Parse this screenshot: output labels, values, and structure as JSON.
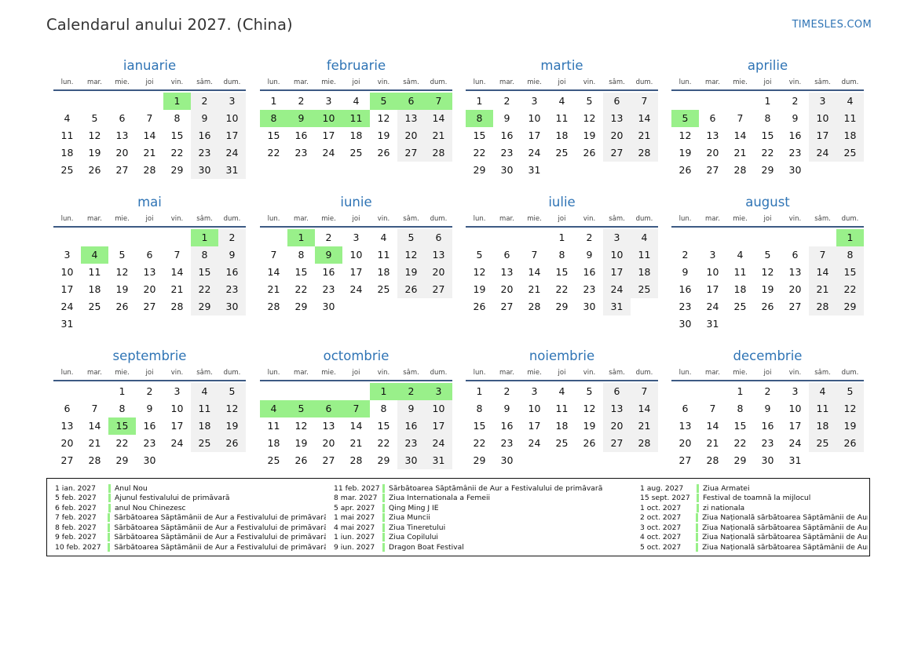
{
  "title": "Calendarul anului 2027. (China)",
  "brand": "TIMESLES.COM",
  "colors": {
    "accent": "#2f74b5",
    "holiday": "#99f08a",
    "weekend": "#f1f1f1",
    "rule": "#3d5a84"
  },
  "weekdays": [
    "lun.",
    "mar.",
    "mie.",
    "joi",
    "vin.",
    "sâm.",
    "dum."
  ],
  "months": [
    {
      "name": "ianuarie",
      "weeks": [
        [
          "",
          "",
          "",
          "",
          "1",
          "2",
          "3"
        ],
        [
          "4",
          "5",
          "6",
          "7",
          "8",
          "9",
          "10"
        ],
        [
          "11",
          "12",
          "13",
          "14",
          "15",
          "16",
          "17"
        ],
        [
          "18",
          "19",
          "20",
          "21",
          "22",
          "23",
          "24"
        ],
        [
          "25",
          "26",
          "27",
          "28",
          "29",
          "30",
          "31"
        ]
      ],
      "holidays": [
        "1"
      ]
    },
    {
      "name": "februarie",
      "weeks": [
        [
          "1",
          "2",
          "3",
          "4",
          "5",
          "6",
          "7"
        ],
        [
          "8",
          "9",
          "10",
          "11",
          "12",
          "13",
          "14"
        ],
        [
          "15",
          "16",
          "17",
          "18",
          "19",
          "20",
          "21"
        ],
        [
          "22",
          "23",
          "24",
          "25",
          "26",
          "27",
          "28"
        ]
      ],
      "holidays": [
        "5",
        "6",
        "7",
        "8",
        "9",
        "10",
        "11"
      ]
    },
    {
      "name": "martie",
      "weeks": [
        [
          "1",
          "2",
          "3",
          "4",
          "5",
          "6",
          "7"
        ],
        [
          "8",
          "9",
          "10",
          "11",
          "12",
          "13",
          "14"
        ],
        [
          "15",
          "16",
          "17",
          "18",
          "19",
          "20",
          "21"
        ],
        [
          "22",
          "23",
          "24",
          "25",
          "26",
          "27",
          "28"
        ],
        [
          "29",
          "30",
          "31",
          "",
          "",
          "",
          ""
        ]
      ],
      "holidays": [
        "8"
      ]
    },
    {
      "name": "aprilie",
      "weeks": [
        [
          "",
          "",
          "",
          "1",
          "2",
          "3",
          "4"
        ],
        [
          "5",
          "6",
          "7",
          "8",
          "9",
          "10",
          "11"
        ],
        [
          "12",
          "13",
          "14",
          "15",
          "16",
          "17",
          "18"
        ],
        [
          "19",
          "20",
          "21",
          "22",
          "23",
          "24",
          "25"
        ],
        [
          "26",
          "27",
          "28",
          "29",
          "30",
          "",
          ""
        ]
      ],
      "holidays": [
        "5"
      ]
    },
    {
      "name": "mai",
      "weeks": [
        [
          "",
          "",
          "",
          "",
          "",
          "1",
          "2"
        ],
        [
          "3",
          "4",
          "5",
          "6",
          "7",
          "8",
          "9"
        ],
        [
          "10",
          "11",
          "12",
          "13",
          "14",
          "15",
          "16"
        ],
        [
          "17",
          "18",
          "19",
          "20",
          "21",
          "22",
          "23"
        ],
        [
          "24",
          "25",
          "26",
          "27",
          "28",
          "29",
          "30"
        ],
        [
          "31",
          "",
          "",
          "",
          "",
          "",
          ""
        ]
      ],
      "holidays": [
        "1",
        "4"
      ]
    },
    {
      "name": "iunie",
      "weeks": [
        [
          "",
          "1",
          "2",
          "3",
          "4",
          "5",
          "6"
        ],
        [
          "7",
          "8",
          "9",
          "10",
          "11",
          "12",
          "13"
        ],
        [
          "14",
          "15",
          "16",
          "17",
          "18",
          "19",
          "20"
        ],
        [
          "21",
          "22",
          "23",
          "24",
          "25",
          "26",
          "27"
        ],
        [
          "28",
          "29",
          "30",
          "",
          "",
          "",
          ""
        ]
      ],
      "holidays": [
        "1",
        "9"
      ]
    },
    {
      "name": "iulie",
      "weeks": [
        [
          "",
          "",
          "",
          "1",
          "2",
          "3",
          "4"
        ],
        [
          "5",
          "6",
          "7",
          "8",
          "9",
          "10",
          "11"
        ],
        [
          "12",
          "13",
          "14",
          "15",
          "16",
          "17",
          "18"
        ],
        [
          "19",
          "20",
          "21",
          "22",
          "23",
          "24",
          "25"
        ],
        [
          "26",
          "27",
          "28",
          "29",
          "30",
          "31",
          ""
        ]
      ],
      "holidays": []
    },
    {
      "name": "august",
      "weeks": [
        [
          "",
          "",
          "",
          "",
          "",
          "",
          "1"
        ],
        [
          "2",
          "3",
          "4",
          "5",
          "6",
          "7",
          "8"
        ],
        [
          "9",
          "10",
          "11",
          "12",
          "13",
          "14",
          "15"
        ],
        [
          "16",
          "17",
          "18",
          "19",
          "20",
          "21",
          "22"
        ],
        [
          "23",
          "24",
          "25",
          "26",
          "27",
          "28",
          "29"
        ],
        [
          "30",
          "31",
          "",
          "",
          "",
          "",
          ""
        ]
      ],
      "holidays": [
        "1"
      ]
    },
    {
      "name": "septembrie",
      "weeks": [
        [
          "",
          "",
          "1",
          "2",
          "3",
          "4",
          "5"
        ],
        [
          "6",
          "7",
          "8",
          "9",
          "10",
          "11",
          "12"
        ],
        [
          "13",
          "14",
          "15",
          "16",
          "17",
          "18",
          "19"
        ],
        [
          "20",
          "21",
          "22",
          "23",
          "24",
          "25",
          "26"
        ],
        [
          "27",
          "28",
          "29",
          "30",
          "",
          "",
          ""
        ]
      ],
      "holidays": [
        "15"
      ]
    },
    {
      "name": "octombrie",
      "weeks": [
        [
          "",
          "",
          "",
          "",
          "1",
          "2",
          "3"
        ],
        [
          "4",
          "5",
          "6",
          "7",
          "8",
          "9",
          "10"
        ],
        [
          "11",
          "12",
          "13",
          "14",
          "15",
          "16",
          "17"
        ],
        [
          "18",
          "19",
          "20",
          "21",
          "22",
          "23",
          "24"
        ],
        [
          "25",
          "26",
          "27",
          "28",
          "29",
          "30",
          "31"
        ]
      ],
      "holidays": [
        "1",
        "2",
        "3",
        "4",
        "5",
        "6",
        "7"
      ]
    },
    {
      "name": "noiembrie",
      "weeks": [
        [
          "1",
          "2",
          "3",
          "4",
          "5",
          "6",
          "7"
        ],
        [
          "8",
          "9",
          "10",
          "11",
          "12",
          "13",
          "14"
        ],
        [
          "15",
          "16",
          "17",
          "18",
          "19",
          "20",
          "21"
        ],
        [
          "22",
          "23",
          "24",
          "25",
          "26",
          "27",
          "28"
        ],
        [
          "29",
          "30",
          "",
          "",
          "",
          "",
          ""
        ]
      ],
      "holidays": []
    },
    {
      "name": "decembrie",
      "weeks": [
        [
          "",
          "",
          "1",
          "2",
          "3",
          "4",
          "5"
        ],
        [
          "6",
          "7",
          "8",
          "9",
          "10",
          "11",
          "12"
        ],
        [
          "13",
          "14",
          "15",
          "16",
          "17",
          "18",
          "19"
        ],
        [
          "20",
          "21",
          "22",
          "23",
          "24",
          "25",
          "26"
        ],
        [
          "27",
          "28",
          "29",
          "30",
          "31",
          "",
          ""
        ]
      ],
      "holidays": []
    }
  ],
  "legend": [
    [
      {
        "date": "1 ian. 2027",
        "name": "Anul Nou"
      },
      {
        "date": "5 feb. 2027",
        "name": "Ajunul festivalului de primăvară"
      },
      {
        "date": "6 feb. 2027",
        "name": "anul Nou Chinezesc"
      },
      {
        "date": "7 feb. 2027",
        "name": "Sărbătoarea Săptămânii de Aur a Festivalului de primăvară"
      },
      {
        "date": "8 feb. 2027",
        "name": "Sărbătoarea Săptămânii de Aur a Festivalului de primăvară"
      },
      {
        "date": "9 feb. 2027",
        "name": "Sărbătoarea Săptămânii de Aur a Festivalului de primăvară"
      },
      {
        "date": "10 feb. 2027",
        "name": "Sărbătoarea Săptămânii de Aur a Festivalului de primăvară"
      }
    ],
    [
      {
        "date": "11 feb. 2027",
        "name": "Sărbătoarea Săptămânii de Aur a Festivalului de primăvară"
      },
      {
        "date": "8 mar. 2027",
        "name": "Ziua Internationala a Femeii"
      },
      {
        "date": "5 apr. 2027",
        "name": "Qing Ming J IE"
      },
      {
        "date": "1 mai 2027",
        "name": "Ziua Muncii"
      },
      {
        "date": "4 mai 2027",
        "name": "Ziua Tineretului"
      },
      {
        "date": "1 iun. 2027",
        "name": "Ziua Copilului"
      },
      {
        "date": "9 iun. 2027",
        "name": "Dragon Boat Festival"
      }
    ],
    [
      {
        "date": "1 aug. 2027",
        "name": "Ziua Armatei"
      },
      {
        "date": "15 sept. 2027",
        "name": "Festival de toamnă la mijlocul"
      },
      {
        "date": "1 oct. 2027",
        "name": "zi nationala"
      },
      {
        "date": "2 oct. 2027",
        "name": "Ziua Națională sărbătoarea Săptămânii de Aur"
      },
      {
        "date": "3 oct. 2027",
        "name": "Ziua Națională sărbătoarea Săptămânii de Aur"
      },
      {
        "date": "4 oct. 2027",
        "name": "Ziua Națională sărbătoarea Săptămânii de Aur"
      },
      {
        "date": "5 oct. 2027",
        "name": "Ziua Națională sărbătoarea Săptămânii de Aur"
      }
    ]
  ]
}
